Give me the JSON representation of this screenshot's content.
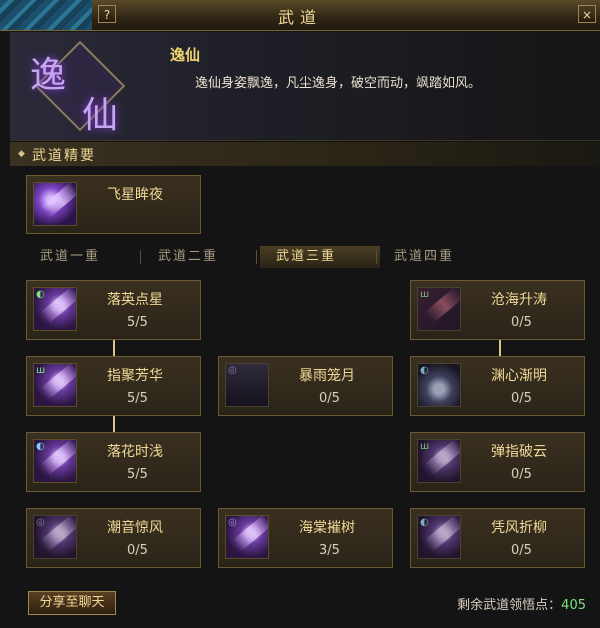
{
  "window": {
    "title": "武道",
    "help_glyph": "?",
    "close_glyph": "×"
  },
  "header": {
    "emblem_glyph_1": "逸",
    "emblem_glyph_2": "仙",
    "name": "逸仙",
    "description": "逸仙身姿飘逸，凡尘逸身，破空而动，飒踏如风。"
  },
  "summary": {
    "section_label": "武道精要",
    "skill_name": "飞星眸夜"
  },
  "tabs": [
    {
      "label": "武道一重",
      "active": false
    },
    {
      "label": "武道二重",
      "active": false
    },
    {
      "label": "武道三重",
      "active": true
    },
    {
      "label": "武道四重",
      "active": false
    }
  ],
  "skills": [
    {
      "name": "落英点星",
      "level": "5/5"
    },
    {
      "name": "指聚芳华",
      "level": "5/5"
    },
    {
      "name": "落花时浅",
      "level": "5/5"
    },
    {
      "name": "潮音惊风",
      "level": "0/5"
    },
    {
      "name": "暴雨笼月",
      "level": "0/5"
    },
    {
      "name": "海棠摧树",
      "level": "3/5"
    },
    {
      "name": "沧海升涛",
      "level": "0/5"
    },
    {
      "name": "渊心渐明",
      "level": "0/5"
    },
    {
      "name": "弹指破云",
      "level": "0/5"
    },
    {
      "name": "凭风折柳",
      "level": "0/5"
    }
  ],
  "footer": {
    "share_label": "分享至聊天",
    "remaining_label": "剩余武道领悟点：",
    "remaining_value": "405"
  },
  "colors": {
    "gold_text": "#f0d896",
    "green_value": "#7de07d",
    "card_border": "#6d5a34"
  }
}
